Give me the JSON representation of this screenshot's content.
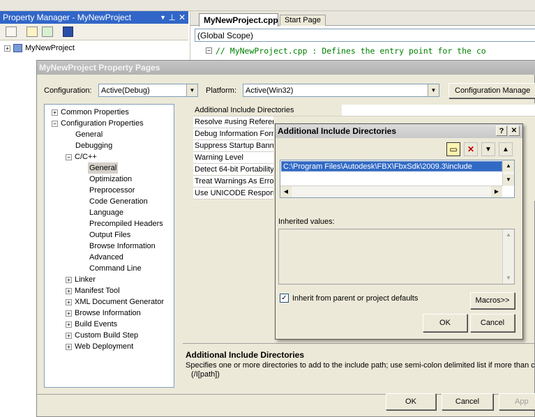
{
  "property_manager": {
    "title": "Property Manager - MyNewProject",
    "project_node": "MyNewProject"
  },
  "editor": {
    "tabs": [
      {
        "label": "MyNewProject.cpp"
      },
      {
        "label": "Start Page"
      }
    ],
    "scope": "(Global Scope)",
    "code_line": "// MyNewProject.cpp : Defines the entry point for the co"
  },
  "property_pages": {
    "title": "MyNewProject Property Pages",
    "configuration_label": "Configuration:",
    "configuration_value": "Active(Debug)",
    "platform_label": "Platform:",
    "platform_value": "Active(Win32)",
    "config_manager_button": "Configuration Manage",
    "tree": [
      {
        "label": "Common Properties",
        "toggle": "+"
      },
      {
        "label": "Configuration Properties",
        "toggle": "-"
      },
      {
        "label": "General",
        "toggle": ""
      },
      {
        "label": "Debugging",
        "toggle": ""
      },
      {
        "label": "C/C++",
        "toggle": "-"
      },
      {
        "label": "General",
        "toggle": "",
        "selected": true
      },
      {
        "label": "Optimization",
        "toggle": ""
      },
      {
        "label": "Preprocessor",
        "toggle": ""
      },
      {
        "label": "Code Generation",
        "toggle": ""
      },
      {
        "label": "Language",
        "toggle": ""
      },
      {
        "label": "Precompiled Headers",
        "toggle": ""
      },
      {
        "label": "Output Files",
        "toggle": ""
      },
      {
        "label": "Browse Information",
        "toggle": ""
      },
      {
        "label": "Advanced",
        "toggle": ""
      },
      {
        "label": "Command Line",
        "toggle": ""
      },
      {
        "label": "Linker",
        "toggle": "+"
      },
      {
        "label": "Manifest Tool",
        "toggle": "+"
      },
      {
        "label": "XML Document Generator",
        "toggle": "+"
      },
      {
        "label": "Browse Information",
        "toggle": "+"
      },
      {
        "label": "Build Events",
        "toggle": "+"
      },
      {
        "label": "Custom Build Step",
        "toggle": "+"
      },
      {
        "label": "Web Deployment",
        "toggle": "+"
      }
    ],
    "properties": [
      {
        "name": "Additional Include Directories"
      },
      {
        "name": "Resolve #using Referen"
      },
      {
        "name": "Debug Information Forn"
      },
      {
        "name": "Suppress Startup Banne"
      },
      {
        "name": "Warning Level"
      },
      {
        "name": "Detect 64-bit Portability"
      },
      {
        "name": "Treat Warnings As Error"
      },
      {
        "name": "Use UNICODE Response"
      }
    ],
    "description_title": "Additional Include Directories",
    "description_text": "Specifies one or more directories to add to the include path; use semi-colon delimited list if more than c",
    "description_switch": "(/I[path])",
    "ok": "OK",
    "cancel": "Cancel",
    "apply": "App"
  },
  "include_dialog": {
    "title": "Additional Include Directories",
    "help": "?",
    "close": "✕",
    "entries": [
      "C:\\Program Files\\Autodesk\\FBX\\FbxSdk\\2009.3\\include"
    ],
    "inherited_label": "Inherited values:",
    "inherit_checkbox": "Inherit from parent or project defaults",
    "inherit_checked": true,
    "macros": "Macros>>",
    "ok": "OK",
    "cancel": "Cancel"
  }
}
